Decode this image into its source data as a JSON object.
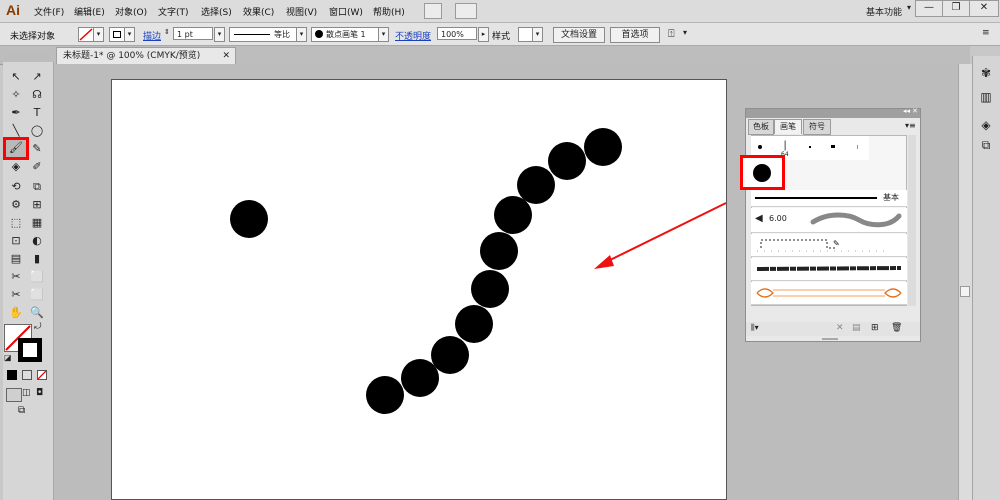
{
  "app": {
    "logo": "Ai",
    "workspace_label": "基本功能",
    "menu": [
      "文件(F)",
      "编辑(E)",
      "对象(O)",
      "文字(T)",
      "选择(S)",
      "效果(C)",
      "视图(V)",
      "窗口(W)",
      "帮助(H)"
    ],
    "win_controls": [
      "—",
      "❐",
      "✕"
    ]
  },
  "control_bar": {
    "selection_status": "未选择对象",
    "stroke_label": "描边",
    "stroke_weight": "1 pt",
    "profile_label": "等比",
    "brush_label": "散点画笔 1",
    "opacity_label": "不透明度",
    "opacity_value": "100%",
    "style_label": "样式",
    "doc_setup_btn": "文档设置",
    "prefs_btn": "首选项"
  },
  "document": {
    "tab_title": "未标题-1* @ 100% (CMYK/预览)",
    "tab_close": "✕"
  },
  "tools": [
    "↖",
    "↗",
    "✧",
    "☊",
    "✒",
    "T",
    "╲",
    "◯",
    "🖌",
    "✎",
    "◈",
    "✐",
    "⟲",
    "⧉",
    "⚙",
    "⊞",
    "⬚",
    "▦",
    "⊡",
    "◐",
    "▤",
    "▮",
    "✂",
    "⬜",
    "✋",
    "🔍"
  ],
  "brush_panel": {
    "tabs": [
      "色板",
      "画笔",
      "符号"
    ],
    "active_tab": "画笔",
    "brush_size_badge": "64",
    "basic_label": "基本",
    "calligraphy_size": "6.00",
    "highlight_color": "#ff0000",
    "arrow_color": "#ee1111"
  }
}
